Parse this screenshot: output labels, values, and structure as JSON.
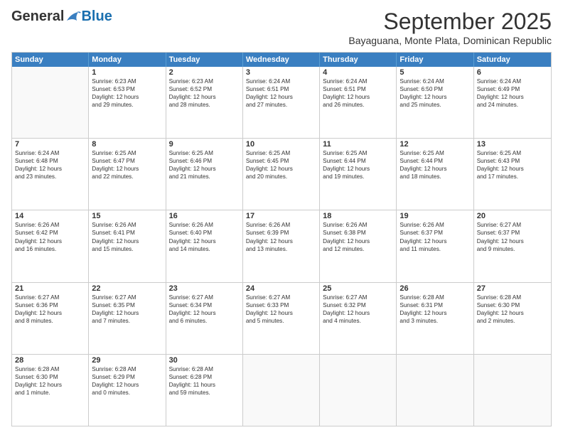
{
  "logo": {
    "general": "General",
    "blue": "Blue"
  },
  "header": {
    "month": "September 2025",
    "location": "Bayaguana, Monte Plata, Dominican Republic"
  },
  "days": [
    "Sunday",
    "Monday",
    "Tuesday",
    "Wednesday",
    "Thursday",
    "Friday",
    "Saturday"
  ],
  "rows": [
    [
      {
        "day": "",
        "empty": true
      },
      {
        "day": "1",
        "l1": "Sunrise: 6:23 AM",
        "l2": "Sunset: 6:53 PM",
        "l3": "Daylight: 12 hours",
        "l4": "and 29 minutes."
      },
      {
        "day": "2",
        "l1": "Sunrise: 6:23 AM",
        "l2": "Sunset: 6:52 PM",
        "l3": "Daylight: 12 hours",
        "l4": "and 28 minutes."
      },
      {
        "day": "3",
        "l1": "Sunrise: 6:24 AM",
        "l2": "Sunset: 6:51 PM",
        "l3": "Daylight: 12 hours",
        "l4": "and 27 minutes."
      },
      {
        "day": "4",
        "l1": "Sunrise: 6:24 AM",
        "l2": "Sunset: 6:51 PM",
        "l3": "Daylight: 12 hours",
        "l4": "and 26 minutes."
      },
      {
        "day": "5",
        "l1": "Sunrise: 6:24 AM",
        "l2": "Sunset: 6:50 PM",
        "l3": "Daylight: 12 hours",
        "l4": "and 25 minutes."
      },
      {
        "day": "6",
        "l1": "Sunrise: 6:24 AM",
        "l2": "Sunset: 6:49 PM",
        "l3": "Daylight: 12 hours",
        "l4": "and 24 minutes."
      }
    ],
    [
      {
        "day": "7",
        "l1": "Sunrise: 6:24 AM",
        "l2": "Sunset: 6:48 PM",
        "l3": "Daylight: 12 hours",
        "l4": "and 23 minutes."
      },
      {
        "day": "8",
        "l1": "Sunrise: 6:25 AM",
        "l2": "Sunset: 6:47 PM",
        "l3": "Daylight: 12 hours",
        "l4": "and 22 minutes."
      },
      {
        "day": "9",
        "l1": "Sunrise: 6:25 AM",
        "l2": "Sunset: 6:46 PM",
        "l3": "Daylight: 12 hours",
        "l4": "and 21 minutes."
      },
      {
        "day": "10",
        "l1": "Sunrise: 6:25 AM",
        "l2": "Sunset: 6:45 PM",
        "l3": "Daylight: 12 hours",
        "l4": "and 20 minutes."
      },
      {
        "day": "11",
        "l1": "Sunrise: 6:25 AM",
        "l2": "Sunset: 6:44 PM",
        "l3": "Daylight: 12 hours",
        "l4": "and 19 minutes."
      },
      {
        "day": "12",
        "l1": "Sunrise: 6:25 AM",
        "l2": "Sunset: 6:44 PM",
        "l3": "Daylight: 12 hours",
        "l4": "and 18 minutes."
      },
      {
        "day": "13",
        "l1": "Sunrise: 6:25 AM",
        "l2": "Sunset: 6:43 PM",
        "l3": "Daylight: 12 hours",
        "l4": "and 17 minutes."
      }
    ],
    [
      {
        "day": "14",
        "l1": "Sunrise: 6:26 AM",
        "l2": "Sunset: 6:42 PM",
        "l3": "Daylight: 12 hours",
        "l4": "and 16 minutes."
      },
      {
        "day": "15",
        "l1": "Sunrise: 6:26 AM",
        "l2": "Sunset: 6:41 PM",
        "l3": "Daylight: 12 hours",
        "l4": "and 15 minutes."
      },
      {
        "day": "16",
        "l1": "Sunrise: 6:26 AM",
        "l2": "Sunset: 6:40 PM",
        "l3": "Daylight: 12 hours",
        "l4": "and 14 minutes."
      },
      {
        "day": "17",
        "l1": "Sunrise: 6:26 AM",
        "l2": "Sunset: 6:39 PM",
        "l3": "Daylight: 12 hours",
        "l4": "and 13 minutes."
      },
      {
        "day": "18",
        "l1": "Sunrise: 6:26 AM",
        "l2": "Sunset: 6:38 PM",
        "l3": "Daylight: 12 hours",
        "l4": "and 12 minutes."
      },
      {
        "day": "19",
        "l1": "Sunrise: 6:26 AM",
        "l2": "Sunset: 6:37 PM",
        "l3": "Daylight: 12 hours",
        "l4": "and 11 minutes."
      },
      {
        "day": "20",
        "l1": "Sunrise: 6:27 AM",
        "l2": "Sunset: 6:37 PM",
        "l3": "Daylight: 12 hours",
        "l4": "and 9 minutes."
      }
    ],
    [
      {
        "day": "21",
        "l1": "Sunrise: 6:27 AM",
        "l2": "Sunset: 6:36 PM",
        "l3": "Daylight: 12 hours",
        "l4": "and 8 minutes."
      },
      {
        "day": "22",
        "l1": "Sunrise: 6:27 AM",
        "l2": "Sunset: 6:35 PM",
        "l3": "Daylight: 12 hours",
        "l4": "and 7 minutes."
      },
      {
        "day": "23",
        "l1": "Sunrise: 6:27 AM",
        "l2": "Sunset: 6:34 PM",
        "l3": "Daylight: 12 hours",
        "l4": "and 6 minutes."
      },
      {
        "day": "24",
        "l1": "Sunrise: 6:27 AM",
        "l2": "Sunset: 6:33 PM",
        "l3": "Daylight: 12 hours",
        "l4": "and 5 minutes."
      },
      {
        "day": "25",
        "l1": "Sunrise: 6:27 AM",
        "l2": "Sunset: 6:32 PM",
        "l3": "Daylight: 12 hours",
        "l4": "and 4 minutes."
      },
      {
        "day": "26",
        "l1": "Sunrise: 6:28 AM",
        "l2": "Sunset: 6:31 PM",
        "l3": "Daylight: 12 hours",
        "l4": "and 3 minutes."
      },
      {
        "day": "27",
        "l1": "Sunrise: 6:28 AM",
        "l2": "Sunset: 6:30 PM",
        "l3": "Daylight: 12 hours",
        "l4": "and 2 minutes."
      }
    ],
    [
      {
        "day": "28",
        "l1": "Sunrise: 6:28 AM",
        "l2": "Sunset: 6:30 PM",
        "l3": "Daylight: 12 hours",
        "l4": "and 1 minute."
      },
      {
        "day": "29",
        "l1": "Sunrise: 6:28 AM",
        "l2": "Sunset: 6:29 PM",
        "l3": "Daylight: 12 hours",
        "l4": "and 0 minutes."
      },
      {
        "day": "30",
        "l1": "Sunrise: 6:28 AM",
        "l2": "Sunset: 6:28 PM",
        "l3": "Daylight: 11 hours",
        "l4": "and 59 minutes."
      },
      {
        "day": "",
        "empty": true
      },
      {
        "day": "",
        "empty": true
      },
      {
        "day": "",
        "empty": true
      },
      {
        "day": "",
        "empty": true
      }
    ]
  ]
}
